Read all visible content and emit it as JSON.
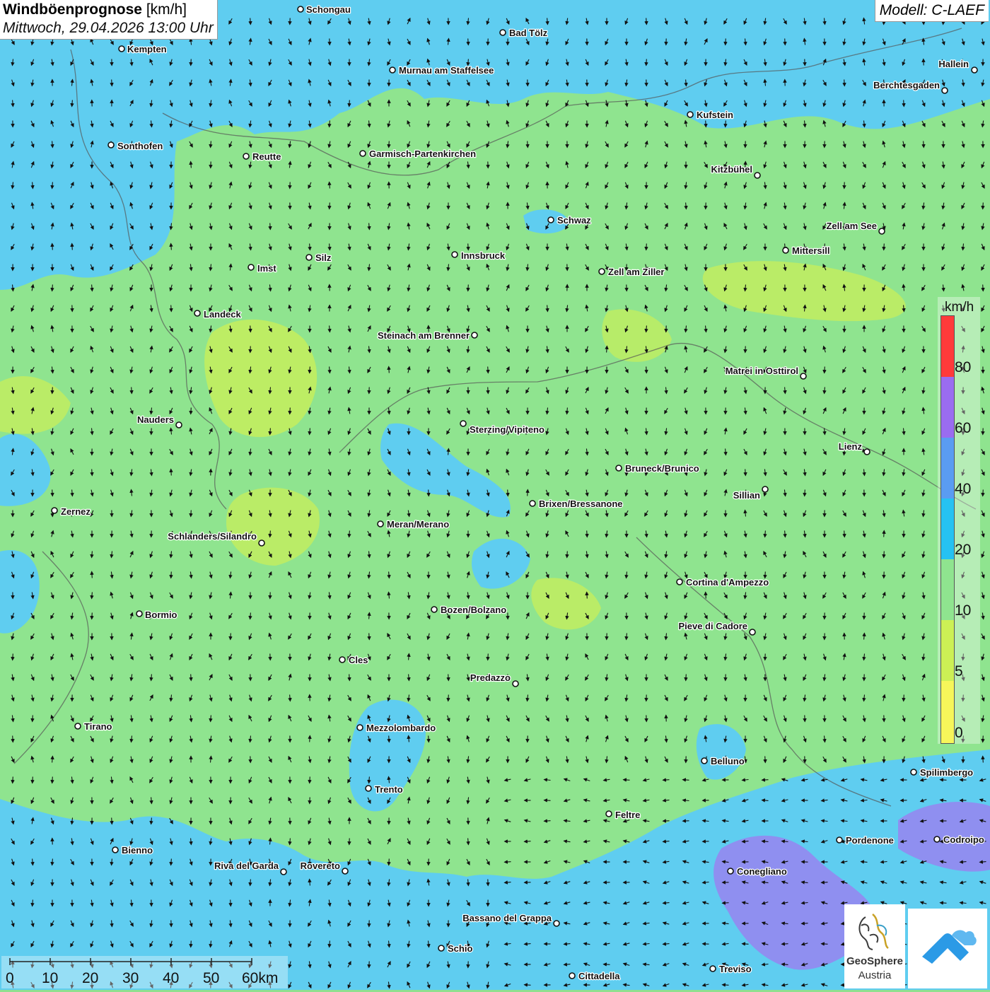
{
  "header": {
    "title_bold": "Windböenprognose",
    "title_unit": "[km/h]",
    "datetime": "Mittwoch, 29.04.2026 13:00 Uhr",
    "model": "Modell: C-LAEF"
  },
  "legend": {
    "unit": "km/h",
    "labels": [
      "80",
      "60",
      "40",
      "20",
      "10",
      "5",
      "0"
    ],
    "colors": [
      "#ff3a3a",
      "#9a6cf0",
      "#5a9cf2",
      "#26c2f2",
      "#8fe48f",
      "#ccf055",
      "#f6f65a"
    ]
  },
  "scale_bar": {
    "labels": [
      "0",
      "10",
      "20",
      "30",
      "40",
      "50",
      "60km"
    ]
  },
  "logo": {
    "name": "GeoSphere",
    "country": "Austria",
    "icon": "geosphere-logo-icon",
    "app_icon": "wind-app-icon"
  },
  "cities": [
    "Schongau",
    "Bad Tölz",
    "Kempten",
    "Murnau am Staffelsee",
    "Hallein",
    "Berchtesgaden",
    "Kufstein",
    "Sonthofen",
    "Reutte",
    "Garmisch-Partenkirchen",
    "Kitzbühel",
    "Schwaz",
    "Zell am See",
    "Mittersill",
    "Innsbruck",
    "Silz",
    "Imst",
    "Zell am Ziller",
    "Landeck",
    "Steinach am Brenner",
    "Matrei in Osttirol",
    "Nauders",
    "Sterzing/Vipiteno",
    "Lienz",
    "Bruneck/Brunico",
    "Sillian",
    "Brixen/Bressanone",
    "Zernez",
    "Meran/Merano",
    "Schlanders/Silandro",
    "Cortina d'Ampezzo",
    "Bozen/Bolzano",
    "Bormio",
    "Pieve di Cadore",
    "Cles",
    "Predazzo",
    "Tirano",
    "Mezzolombardo",
    "Belluno",
    "Spilimbergo",
    "Trento",
    "Feltre",
    "Pordenone",
    "Codroipo",
    "Bienno",
    "Riva del Garda",
    "Rovereto",
    "Conegliano",
    "Bassano del Grappa",
    "Schio",
    "Treviso",
    "Cittadella"
  ],
  "colors": {
    "calm": "#8fe48f",
    "breezy": "#ccf055",
    "windy": "#5fcdf0",
    "strong": "#8f8ff0"
  }
}
